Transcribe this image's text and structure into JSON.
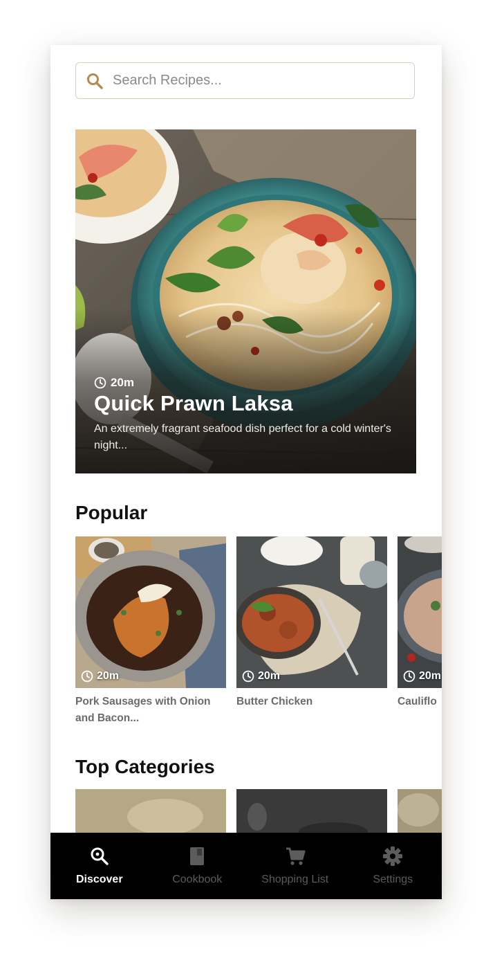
{
  "colors": {
    "accent": "#b08d4a",
    "tabbar_bg": "#000000",
    "tab_active": "#ffffff",
    "tab_inactive": "#5c5c5c"
  },
  "search": {
    "placeholder": "Search Recipes...",
    "icon": "search-icon"
  },
  "featured": {
    "time": "20m",
    "title": "Quick Prawn Laksa",
    "description": "An extremely fragrant seafood dish perfect for a cold winter's night..."
  },
  "popular": {
    "heading": "Popular",
    "items": [
      {
        "time": "20m",
        "name": "Pork Sausages with Onion and Bacon..."
      },
      {
        "time": "20m",
        "name": "Butter Chicken"
      },
      {
        "time": "20m",
        "name": "Cauliflo"
      }
    ]
  },
  "categories": {
    "heading": "Top Categories"
  },
  "tabs": [
    {
      "label": "Discover",
      "icon": "discover-search-icon",
      "active": true
    },
    {
      "label": "Cookbook",
      "icon": "book-icon",
      "active": false
    },
    {
      "label": "Shopping List",
      "icon": "cart-icon",
      "active": false
    },
    {
      "label": "Settings",
      "icon": "gear-icon",
      "active": false
    }
  ]
}
